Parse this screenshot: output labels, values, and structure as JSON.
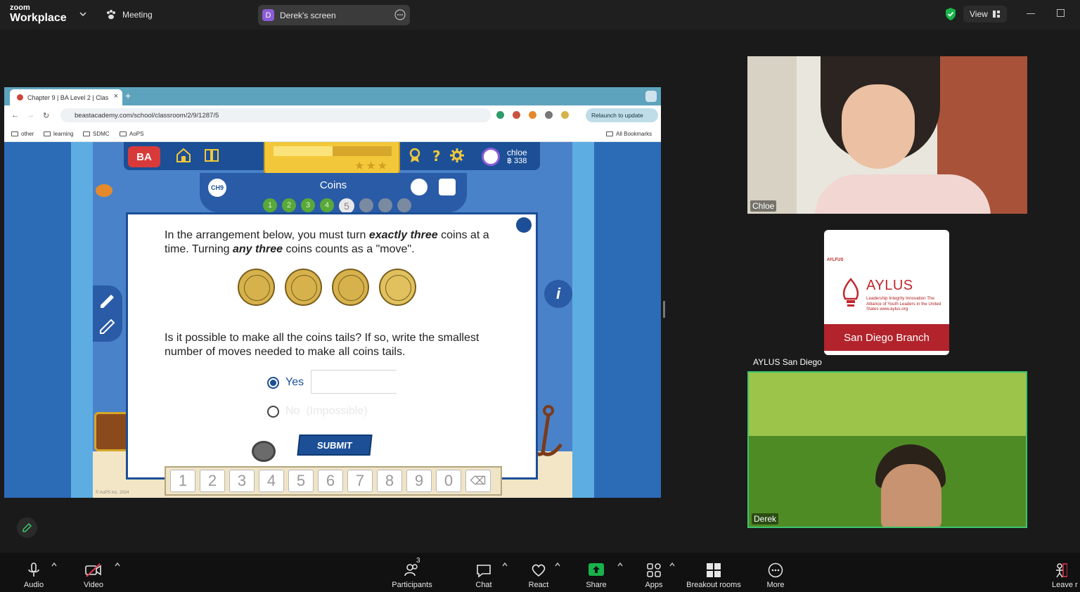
{
  "zoom": {
    "logo_top": "zoom",
    "logo_bottom": "Workplace",
    "meeting_label": "Meeting",
    "share_pill": {
      "initial": "D",
      "label": "Derek's screen"
    },
    "view_label": "View"
  },
  "browser": {
    "tab_title": "Chapter 9 | BA Level 2 | Clas",
    "url": "beastacademy.com/school/classroom/2/9/1287/5",
    "relaunch_label": "Relaunch to update",
    "bookmarks": [
      "other",
      "learning",
      "SDMC",
      "AoPS"
    ],
    "all_bookmarks": "All Bookmarks"
  },
  "game": {
    "logo": "BA",
    "user_name": "chloe",
    "user_points": "฿ 338",
    "lesson_badge": "CH9",
    "lesson_title": "Coins",
    "steps": [
      {
        "n": "1",
        "state": "done"
      },
      {
        "n": "2",
        "state": "done"
      },
      {
        "n": "3",
        "state": "done"
      },
      {
        "n": "4",
        "state": "done"
      },
      {
        "n": "5",
        "state": "current"
      },
      {
        "n": "6",
        "state": "todo"
      },
      {
        "n": "7",
        "state": "todo"
      },
      {
        "n": "8",
        "state": "todo"
      }
    ],
    "question_part1": "In the arrangement below, you must turn ",
    "question_em1": "exactly three",
    "question_part2": " coins at a time. Turning ",
    "question_em2": "any three",
    "question_part3": " coins counts as a \"move\".",
    "coins": [
      "heads",
      "heads",
      "heads",
      "tails"
    ],
    "question2": "Is it possible to make all the coins tails? If so, write the smallest number of moves needed to make all coins tails.",
    "option_yes": "Yes",
    "option_no": "No",
    "option_no_note": "(Impossible)",
    "answer_value": "",
    "submit_label": "SUBMIT",
    "keypad": [
      "1",
      "2",
      "3",
      "4",
      "5",
      "6",
      "7",
      "8",
      "9",
      "0"
    ],
    "backspace": "⌫",
    "info": "i",
    "copyright": "© AoPS Inc. 2024"
  },
  "participants": {
    "chloe": "Chloe",
    "aylus": {
      "name": "AYLUS San Diego",
      "mini": "AYLFUS",
      "brand": "AYLUS",
      "tagline": "Leadership Integrity Innovation The Alliance of Youth Leaders in the United States www.aylus.org",
      "branch": "San Diego Branch"
    },
    "derek": "Derek"
  },
  "toolbar": {
    "audio": "Audio",
    "video": "Video",
    "participants": "Participants",
    "participants_count": "3",
    "chat": "Chat",
    "react": "React",
    "share": "Share",
    "apps": "Apps",
    "breakout": "Breakout rooms",
    "more": "More",
    "leave": "Leave r"
  },
  "colors": {
    "zoom_bg": "#1a1a1a",
    "share_green": "#19b24b",
    "active_speaker": "#3ec46d",
    "game_blue": "#1c4f96"
  }
}
